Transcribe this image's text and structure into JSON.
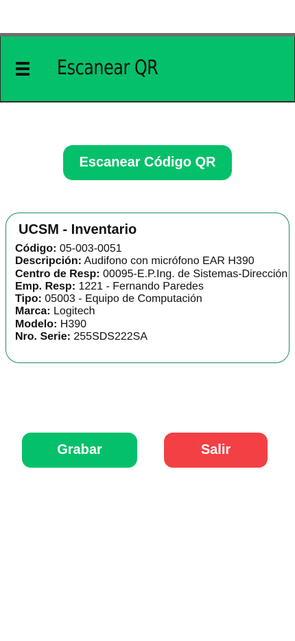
{
  "header": {
    "menu_icon": "hamburger-menu-icon",
    "title": "Escanear QR"
  },
  "scan": {
    "button_label": "Escanear Código QR"
  },
  "card": {
    "title": "UCSM - Inventario",
    "fields": [
      {
        "label": "Código:",
        "value": "05-003-0051"
      },
      {
        "label": "Descripción:",
        "value": "Audifono con micrófono EAR H390"
      },
      {
        "label": "Centro de Resp:",
        "value": "00095-E.P.Ing. de Sistemas-Dirección"
      },
      {
        "label": "Emp. Resp:",
        "value": "1221 - Fernando Paredes"
      },
      {
        "label": "Tipo:",
        "value": "05003 - Equipo de Computación"
      },
      {
        "label": "Marca:",
        "value": "Logitech"
      },
      {
        "label": "Modelo:",
        "value": "H390"
      },
      {
        "label": "Nro. Serie:",
        "value": "255SDS222SA"
      }
    ]
  },
  "actions": {
    "save_label": "Grabar",
    "exit_label": "Salir"
  },
  "colors": {
    "primary_green": "#05c06a",
    "danger_red": "#f34044",
    "card_border": "#1f8a6a"
  }
}
